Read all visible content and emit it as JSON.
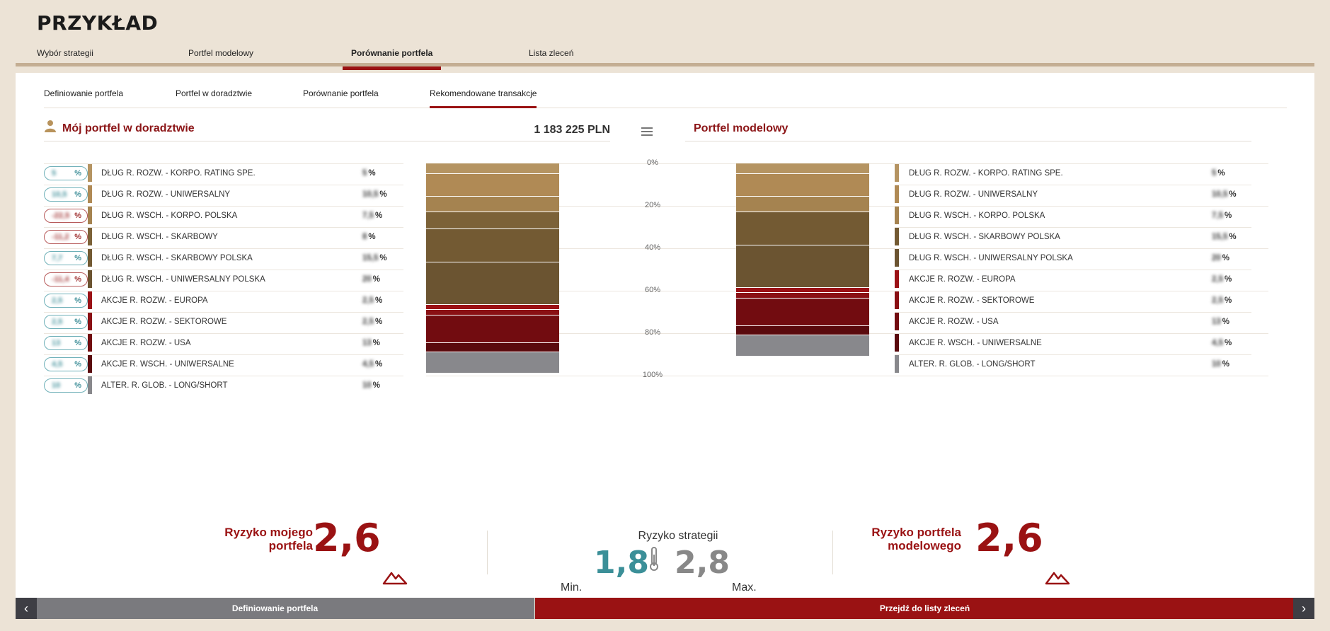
{
  "brand": {
    "logo": "PRZYKŁAD"
  },
  "top_tabs": [
    {
      "label": "Wybór strategii"
    },
    {
      "label": "Portfel modelowy"
    },
    {
      "label": "Porównanie portfela"
    },
    {
      "label": "Lista zleceń"
    }
  ],
  "sub_tabs": [
    {
      "label": "Definiowanie portfela"
    },
    {
      "label": "Portfel w doradztwie"
    },
    {
      "label": "Porównanie portfela"
    },
    {
      "label": "Rekomendowane transakcje"
    }
  ],
  "my_portfolio": {
    "title": "Mój portfel w doradztwie",
    "amount": "1 183 225 PLN",
    "rows": [
      {
        "change": "5",
        "label": "DŁUG R. ROZW. - KORPO. RATING SPE.",
        "value": "5",
        "color": "#b59462"
      },
      {
        "change": "10,5",
        "label": "DŁUG R. ROZW. - UNIWERSALNY",
        "value": "10,5",
        "color": "#b08a55"
      },
      {
        "change": "-22,5",
        "label": "DŁUG R. WSCH. - KORPO. POLSKA",
        "value": "7,5",
        "color": "#a58350"
      },
      {
        "change": "-11,2",
        "label": "DŁUG R. WSCH. - SKARBOWY",
        "value": "8",
        "color": "#7c6238"
      },
      {
        "change": "7,7",
        "label": "DŁUG R. WSCH. - SKARBOWY POLSKA",
        "value": "15,5",
        "color": "#735a33"
      },
      {
        "change": "-11,4",
        "label": "DŁUG R. WSCH. - UNIWERSALNY POLSKA",
        "value": "20",
        "color": "#6b5431"
      },
      {
        "change": "2,5",
        "label": "AKCJE R. ROZW. - EUROPA",
        "value": "2,5",
        "color": "#9b1216"
      },
      {
        "change": "2,5",
        "label": "AKCJE R. ROZW. - SEKTOROWE",
        "value": "2,5",
        "color": "#8a1014"
      },
      {
        "change": "13",
        "label": "AKCJE R. ROZW. - USA",
        "value": "13",
        "color": "#720c10"
      },
      {
        "change": "4,5",
        "label": "AKCJE R. WSCH. - UNIWERSALNE",
        "value": "4,5",
        "color": "#5a0a0d"
      },
      {
        "change": "10",
        "label": "ALTER. R. GLOB. - LONG/SHORT",
        "value": "10",
        "color": "#88888c"
      }
    ]
  },
  "model_portfolio": {
    "title": "Portfel modelowy",
    "rows": [
      {
        "label": "DŁUG R. ROZW. - KORPO. RATING SPE.",
        "value": "5",
        "color": "#b59462"
      },
      {
        "label": "DŁUG R. ROZW. - UNIWERSALNY",
        "value": "10,5",
        "color": "#b08a55"
      },
      {
        "label": "DŁUG R. WSCH. - KORPO. POLSKA",
        "value": "7,5",
        "color": "#a58350"
      },
      {
        "label": "DŁUG R. WSCH. - SKARBOWY POLSKA",
        "value": "15,5",
        "color": "#735a33"
      },
      {
        "label": "DŁUG R. WSCH. - UNIWERSALNY POLSKA",
        "value": "20",
        "color": "#6b5431"
      },
      {
        "label": "AKCJE R. ROZW. - EUROPA",
        "value": "2,5",
        "color": "#9b1216"
      },
      {
        "label": "AKCJE R. ROZW. - SEKTOROWE",
        "value": "2,5",
        "color": "#8a1014"
      },
      {
        "label": "AKCJE R. ROZW. - USA",
        "value": "13",
        "color": "#720c10"
      },
      {
        "label": "AKCJE R. WSCH. - UNIWERSALNE",
        "value": "4,5",
        "color": "#5a0a0d"
      },
      {
        "label": "ALTER. R. GLOB. - LONG/SHORT",
        "value": "10",
        "color": "#88888c"
      }
    ]
  },
  "pct_unit": "%",
  "chart_data": {
    "type": "bar",
    "stacked": true,
    "axis_labels": [
      "0%",
      "20%",
      "40%",
      "60%",
      "80%",
      "100%"
    ],
    "ylim": [
      0,
      100
    ],
    "series": [
      {
        "values": [
          5,
          10.5,
          7.5,
          8,
          15.5,
          20,
          2.5,
          2.5,
          13,
          4.5,
          10
        ]
      },
      {
        "values": [
          5,
          10.5,
          7.5,
          15.5,
          20,
          2.5,
          2.5,
          13,
          4.5,
          10
        ]
      }
    ],
    "colors_my": [
      "#b59462",
      "#b08a55",
      "#a58350",
      "#7c6238",
      "#735a33",
      "#6b5431",
      "#9b1216",
      "#8a1014",
      "#720c10",
      "#5a0a0d",
      "#88888c"
    ],
    "colors_model": [
      "#b59462",
      "#b08a55",
      "#a58350",
      "#735a33",
      "#6b5431",
      "#9b1216",
      "#8a1014",
      "#720c10",
      "#5a0a0d",
      "#88888c"
    ]
  },
  "risk": {
    "mine_label": "Ryzyko mojego portfela",
    "mine_value": "2,6",
    "strategy_title": "Ryzyko strategii",
    "min_label": "Min.",
    "min_value": "1,8",
    "max_value": "2,8",
    "max_label": "Max.",
    "model_label": "Ryzyko portfela modelowego",
    "model_value": "2,6"
  },
  "footer": {
    "left_label": "Definiowanie portfela",
    "right_label": "Przejdź do listy zleceń",
    "prev_icon": "‹",
    "next_icon": "›"
  }
}
